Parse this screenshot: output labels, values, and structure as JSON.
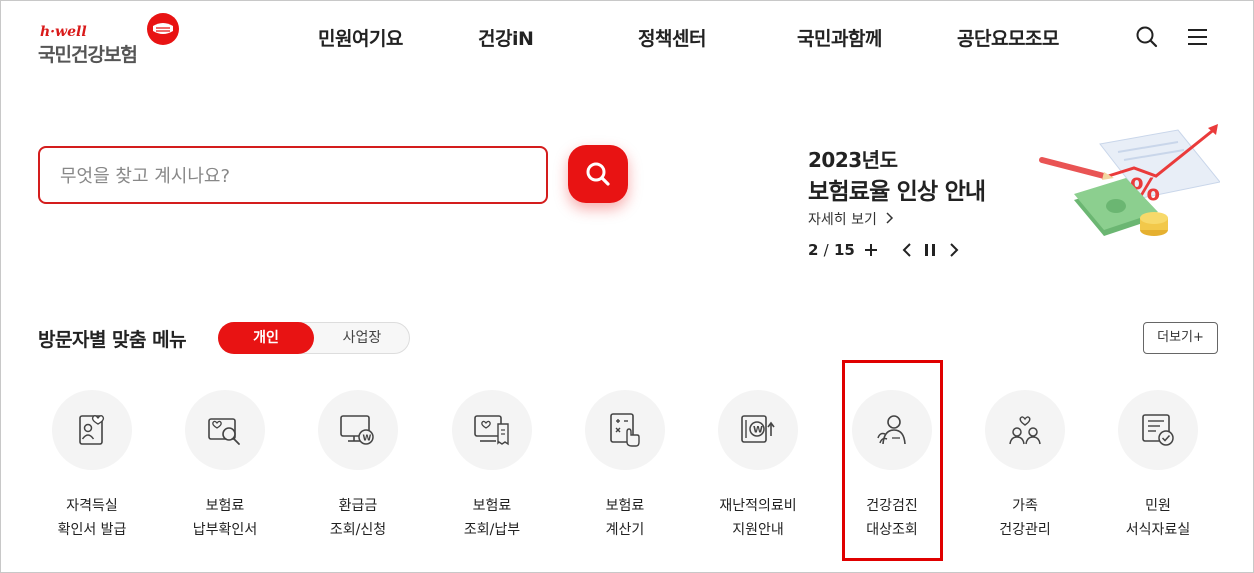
{
  "logo": {
    "small": "h·well",
    "main": "국민건강보험"
  },
  "nav": [
    "민원여기요",
    "건강iN",
    "정책센터",
    "국민과함께",
    "공단요모조모"
  ],
  "header_icons": [
    "search-icon",
    "menu-icon"
  ],
  "search": {
    "placeholder": "무엇을 찾고 계시나요?"
  },
  "banner": {
    "year": "2023년도",
    "title": "보험료율 인상 안내",
    "link": "자세히 보기",
    "current": "2",
    "separator": "/",
    "total": "15"
  },
  "visitor": {
    "title": "방문자별 맞춤 메뉴",
    "tab_personal": "개인",
    "tab_business": "사업장",
    "more": "더보기+"
  },
  "menu": [
    {
      "icon": "id-card-icon",
      "line1": "자격득실",
      "line2": "확인서 발급"
    },
    {
      "icon": "payment-search-icon",
      "line1": "보험료",
      "line2": "납부확인서"
    },
    {
      "icon": "refund-monitor-icon",
      "line1": "환급금",
      "line2": "조회/신청"
    },
    {
      "icon": "bill-monitor-icon",
      "line1": "보험료",
      "line2": "조회/납부"
    },
    {
      "icon": "calculator-icon",
      "line1": "보험료",
      "line2": "계산기"
    },
    {
      "icon": "medical-support-icon",
      "line1": "재난적의료비",
      "line2": "지원안내"
    },
    {
      "icon": "health-check-person-icon",
      "line1": "건강검진",
      "line2": "대상조회"
    },
    {
      "icon": "family-health-icon",
      "line1": "가족",
      "line2": "건강관리"
    },
    {
      "icon": "document-check-icon",
      "line1": "민원",
      "line2": "서식자료실"
    }
  ],
  "colors": {
    "brand_red": "#e81313",
    "highlight": "#e00000"
  }
}
